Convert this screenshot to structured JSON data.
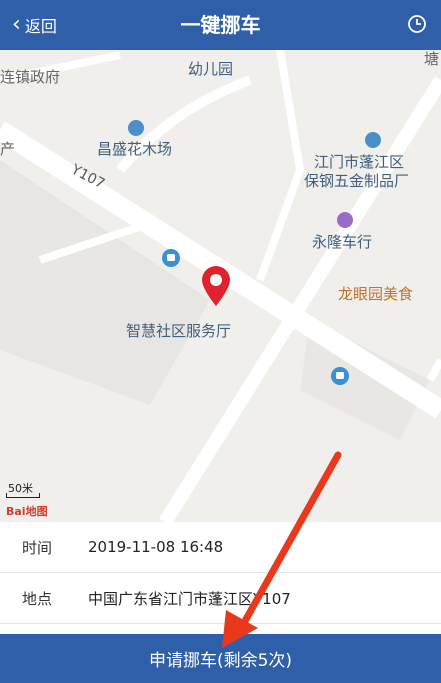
{
  "header": {
    "back_label": "返回",
    "title": "一键挪车",
    "history_icon": "clock-icon"
  },
  "map": {
    "road_label": "Y107",
    "pois": [
      "幼儿园",
      "连镇政府",
      "昌盛花木场",
      "江门市蓬江区",
      "保钢五金制品厂",
      "永隆车行",
      "龙眼园美食",
      "智慧社区服务厅",
      "产",
      "塘"
    ],
    "scale": "50米",
    "attribution": "Bai地图"
  },
  "info": [
    {
      "label": "时间",
      "value": "2019-11-08 16:48"
    },
    {
      "label": "地点",
      "value": "中国广东省江门市蓬江区Y107"
    }
  ],
  "action": {
    "label": "申请挪车(剩余5次)"
  },
  "colors": {
    "primary": "#2f5fa8",
    "pin": "#e0222f",
    "arrow": "#e8391c"
  }
}
